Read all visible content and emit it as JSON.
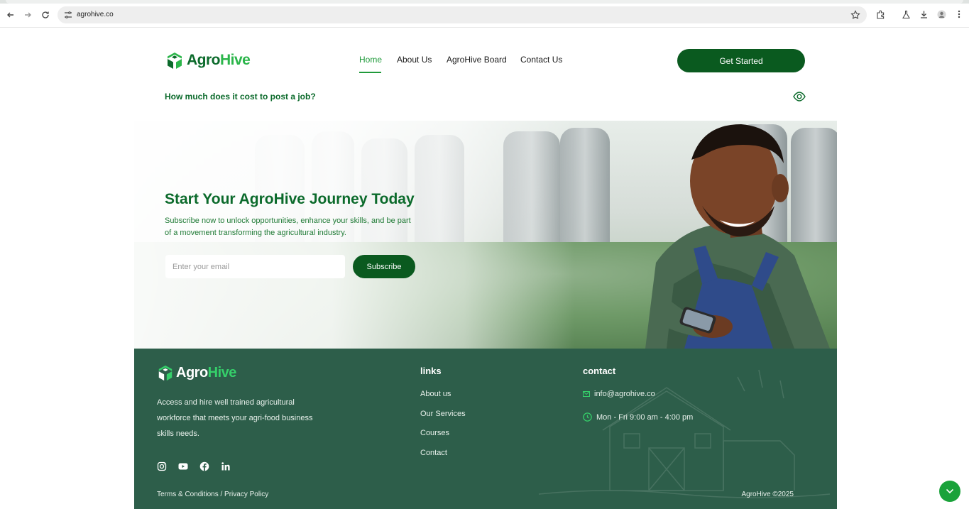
{
  "browser": {
    "url": "agrohive.co"
  },
  "header": {
    "logo": {
      "part1": "Agro",
      "part2": "Hive"
    },
    "nav": [
      {
        "label": "Home",
        "active": true
      },
      {
        "label": "About Us"
      },
      {
        "label": "AgroHive Board"
      },
      {
        "label": "Contact Us"
      }
    ],
    "cta_label": "Get Started"
  },
  "faq": {
    "question": "How much does it cost to post a job?"
  },
  "hero": {
    "title": "Start Your AgroHive Journey Today",
    "subtitle": "Subscribe now to unlock opportunities, enhance your skills, and be part of a movement transforming the agricultural industry.",
    "email_placeholder": "Enter your email",
    "subscribe_label": "Subscribe"
  },
  "footer": {
    "logo": {
      "part1": "Agro",
      "part2": "Hive"
    },
    "description": "Access and hire well trained agricultural workforce that meets your agri-food business skills needs.",
    "social_icons": [
      "instagram-icon",
      "youtube-icon",
      "facebook-icon",
      "linkedin-icon"
    ],
    "links_heading": "links",
    "links": [
      "About us",
      "Our Services",
      "Courses",
      "Contact"
    ],
    "contact_heading": "contact",
    "email": "info@agrohive.co",
    "hours": "Mon - Fri 9:00 am - 4:00 pm",
    "terms": "Terms & Conditions / Privacy Policy",
    "copyright": "AgroHive ©2025"
  },
  "colors": {
    "brand_dark": "#0a5a1f",
    "brand_green": "#1f9a3a",
    "footer_bg": "#2d5e4a"
  }
}
